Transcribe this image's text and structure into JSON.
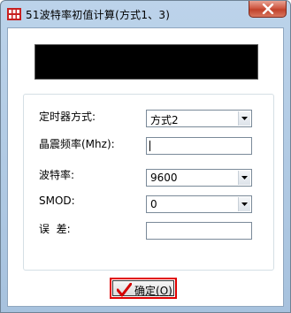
{
  "window": {
    "title": "51波特率初值计算(方式1、3)",
    "icon": "app-logo-icon",
    "close_icon": "close-icon"
  },
  "display": {
    "value": ""
  },
  "form": {
    "timer_mode": {
      "label": "定时器方式:",
      "value": "方式2"
    },
    "crystal": {
      "label": "晶震频率(Mhz):",
      "value": ""
    },
    "baud_rate": {
      "label": "波特率:",
      "value": "9600"
    },
    "smod": {
      "label": "SMOD:",
      "value": "0"
    },
    "error": {
      "label": "误  差:",
      "value": ""
    }
  },
  "ok_button": {
    "label": "确定",
    "accesskey_label": "(O)",
    "icon": "checkmark-icon"
  },
  "colors": {
    "title_bar": "#bcd3ea",
    "close_button": "#c1422b",
    "display_bg": "#000000",
    "ok_highlight": "#e00000",
    "check_red": "#d40000"
  }
}
